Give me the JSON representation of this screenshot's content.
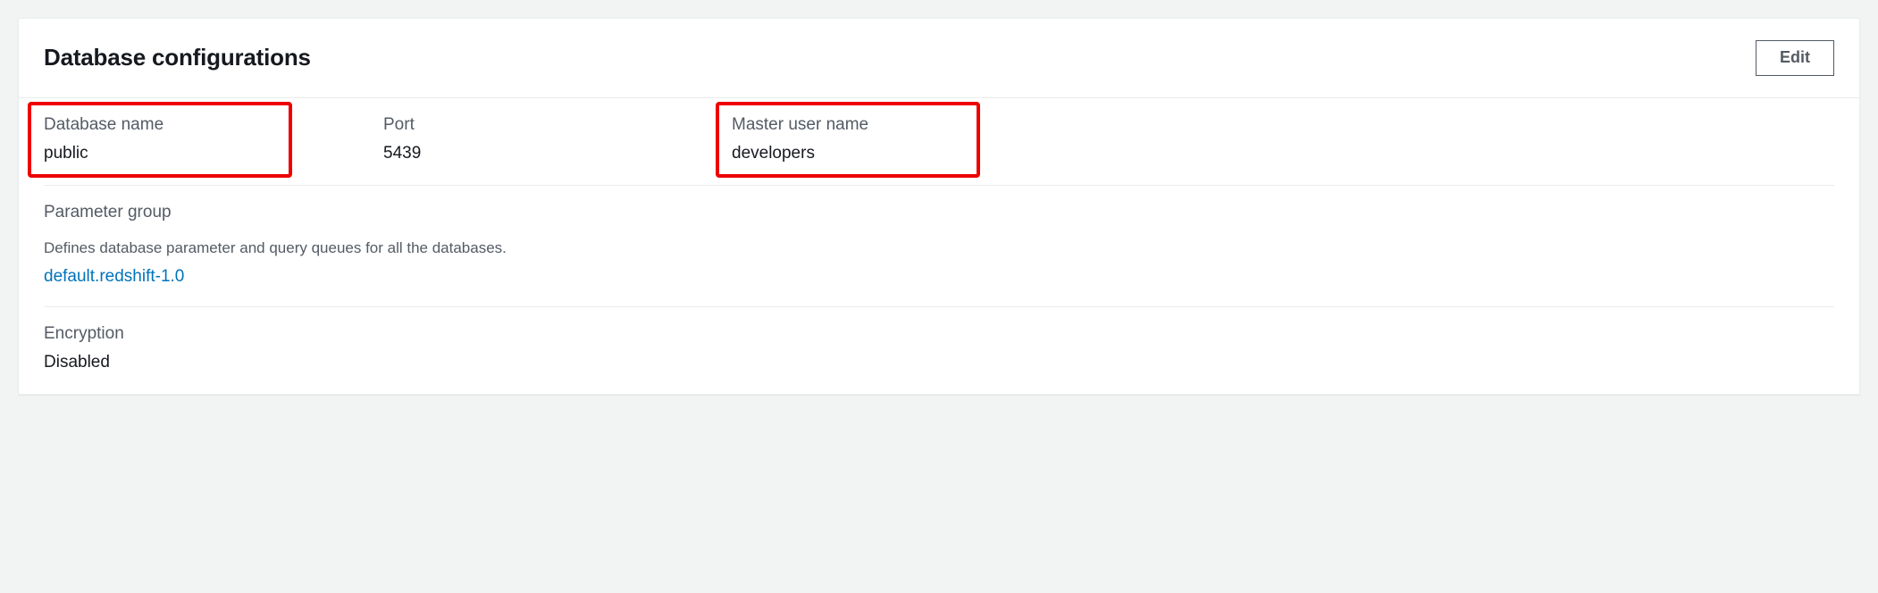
{
  "panel": {
    "title": "Database configurations",
    "edit_label": "Edit"
  },
  "fields": {
    "database_name": {
      "label": "Database name",
      "value": "public"
    },
    "port": {
      "label": "Port",
      "value": "5439"
    },
    "master_user_name": {
      "label": "Master user name",
      "value": "developers"
    },
    "parameter_group": {
      "label": "Parameter group",
      "description": "Defines database parameter and query queues for all the databases.",
      "link_text": "default.redshift-1.0"
    },
    "encryption": {
      "label": "Encryption",
      "value": "Disabled"
    }
  }
}
